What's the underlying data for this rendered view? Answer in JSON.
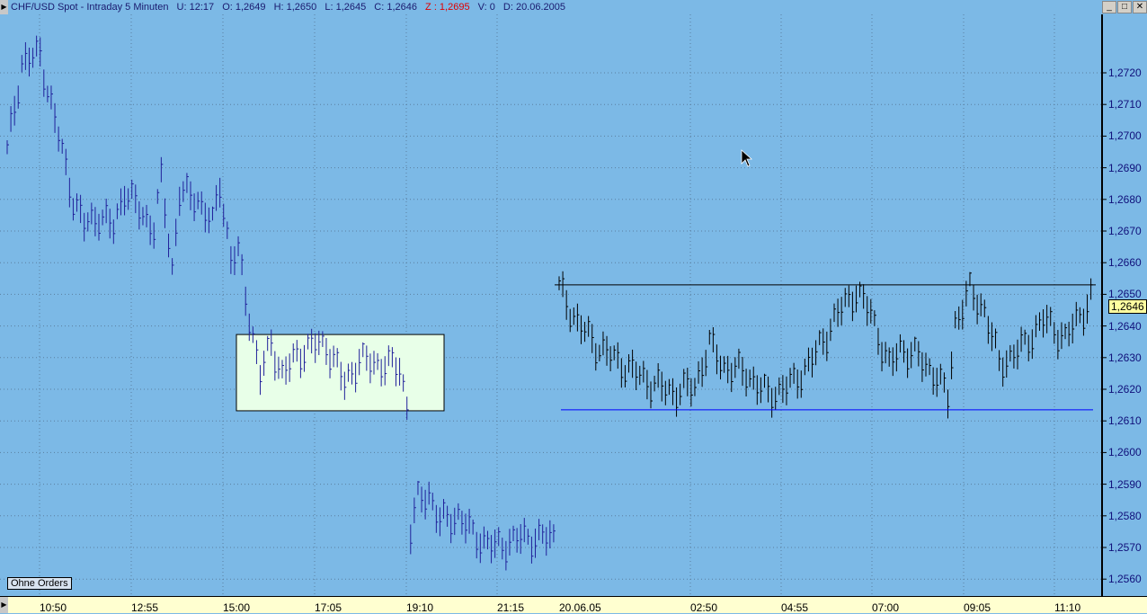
{
  "title": {
    "instrument": "CHF/USD Spot - Intraday 5 Minuten",
    "u": "U: 12:17",
    "o": "O: 1,2649",
    "h": "H: 1,2650",
    "l": "L: 1,2645",
    "c": "C: 1,2646",
    "z": "Z : 1,2695",
    "v": "V: 0",
    "d": "D: 20.06.2005"
  },
  "window_buttons": {
    "minimize": "_",
    "maximize": "□",
    "close": "✕"
  },
  "orders_label": "Ohne Orders",
  "current_price": "1,2646",
  "colors": {
    "background": "#7cb9e6",
    "left_bars": "#20209a",
    "right_bars": "#000000",
    "box": "#e8ffe8",
    "support": "#0000ff"
  },
  "chart_data": {
    "type": "ohlc",
    "title": "CHF/USD Spot - Intraday 5 Minuten",
    "ylim": [
      1.2555,
      1.2735
    ],
    "y_ticks": [
      "1,2720",
      "1,2710",
      "1,2700",
      "1,2690",
      "1,2680",
      "1,2670",
      "1,2660",
      "1,2650",
      "1,2640",
      "1,2630",
      "1,2620",
      "1,2610",
      "1,2600",
      "1,2590",
      "1,2580",
      "1,2570",
      "1,2560"
    ],
    "x_ticks": [
      "10:50",
      "12:55",
      "15:00",
      "17:05",
      "19:10",
      "21:15",
      "20.06.05",
      "02:50",
      "04:55",
      "07:00",
      "09:05",
      "11:10"
    ],
    "series": [
      {
        "name": "session-1",
        "points": [
          [
            0,
            1.2695
          ],
          [
            4,
            1.2723
          ],
          [
            9,
            1.2726
          ],
          [
            11,
            1.2715
          ],
          [
            14,
            1.27
          ],
          [
            18,
            1.268
          ],
          [
            21,
            1.2672
          ],
          [
            25,
            1.2675
          ],
          [
            29,
            1.2671
          ],
          [
            32,
            1.2683
          ],
          [
            37,
            1.2675
          ],
          [
            40,
            1.2671
          ],
          [
            42,
            1.2686
          ],
          [
            45,
            1.2658
          ],
          [
            47,
            1.2682
          ],
          [
            52,
            1.268
          ],
          [
            56,
            1.2672
          ],
          [
            58,
            1.2685
          ],
          [
            61,
            1.2661
          ],
          [
            63,
            1.2663
          ],
          [
            66,
            1.2643
          ],
          [
            69,
            1.2624
          ],
          [
            72,
            1.2635
          ],
          [
            75,
            1.2624
          ],
          [
            79,
            1.2631
          ],
          [
            84,
            1.2634
          ],
          [
            87,
            1.2634
          ],
          [
            92,
            1.2622
          ],
          [
            96,
            1.2629
          ],
          [
            101,
            1.2628
          ],
          [
            107,
            1.2627
          ],
          [
            109,
            1.2615
          ],
          [
            110,
            1.2575
          ],
          [
            112,
            1.2585
          ],
          [
            115,
            1.2587
          ],
          [
            118,
            1.2578
          ],
          [
            123,
            1.258
          ],
          [
            127,
            1.2574
          ],
          [
            133,
            1.257
          ],
          [
            140,
            1.2573
          ],
          [
            149,
            1.2573
          ]
        ]
      },
      {
        "name": "session-2",
        "points": [
          [
            0,
            1.2652
          ],
          [
            5,
            1.2641
          ],
          [
            10,
            1.2634
          ],
          [
            17,
            1.2628
          ],
          [
            25,
            1.2622
          ],
          [
            31,
            1.2619
          ],
          [
            37,
            1.2621
          ],
          [
            41,
            1.2634
          ],
          [
            45,
            1.2627
          ],
          [
            51,
            1.2625
          ],
          [
            57,
            1.2618
          ],
          [
            64,
            1.2622
          ],
          [
            70,
            1.2631
          ],
          [
            76,
            1.2644
          ],
          [
            81,
            1.2651
          ],
          [
            85,
            1.2644
          ],
          [
            90,
            1.2627
          ],
          [
            93,
            1.2633
          ],
          [
            98,
            1.263
          ],
          [
            103,
            1.2624
          ],
          [
            106,
            1.2617
          ],
          [
            108,
            1.2641
          ],
          [
            112,
            1.2651
          ],
          [
            116,
            1.2645
          ],
          [
            120,
            1.2628
          ],
          [
            123,
            1.263
          ],
          [
            127,
            1.2634
          ],
          [
            132,
            1.2642
          ],
          [
            138,
            1.2636
          ],
          [
            142,
            1.2643
          ],
          [
            145,
            1.2649
          ]
        ]
      }
    ],
    "annotations": {
      "resistance": 1.2653,
      "support": 1.26135,
      "box": {
        "from_price": 1.26373,
        "to_price": 1.26132
      }
    }
  }
}
